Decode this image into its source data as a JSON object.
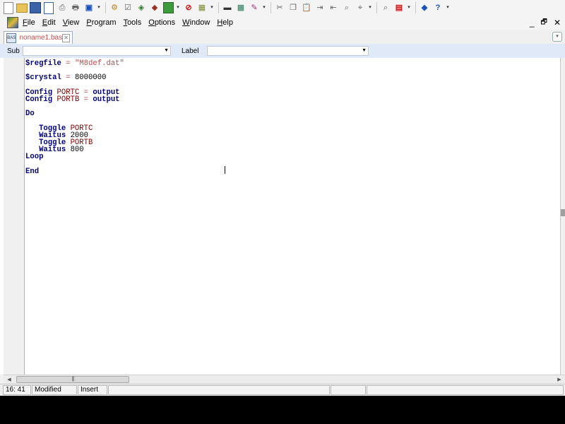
{
  "menu": {
    "items": [
      {
        "label": "File",
        "u": "F",
        "rest": "ile"
      },
      {
        "label": "Edit",
        "u": "E",
        "rest": "dit"
      },
      {
        "label": "View",
        "u": "V",
        "rest": "iew"
      },
      {
        "label": "Program",
        "u": "P",
        "rest": "rogram"
      },
      {
        "label": "Tools",
        "u": "T",
        "rest": "ools"
      },
      {
        "label": "Options",
        "u": "O",
        "rest": "ptions"
      },
      {
        "label": "Window",
        "u": "W",
        "rest": "indow"
      },
      {
        "label": "Help",
        "u": "H",
        "rest": "elp"
      }
    ],
    "window_controls": {
      "minimize": "_",
      "restore": "🗗",
      "close": "✕"
    }
  },
  "tabs": [
    {
      "label": "noname1.bas",
      "icon": "bas-file-icon",
      "icon_text": "BAS"
    }
  ],
  "subbar": {
    "sub_label": "Sub",
    "label_label": "Label",
    "sub_value": "",
    "label_value": ""
  },
  "editor": {
    "lines": [
      [
        {
          "t": "$regfile",
          "c": "kw"
        },
        {
          "t": " = ",
          "c": "str"
        },
        {
          "t": "\"M8def.dat\"",
          "c": "str"
        }
      ],
      [],
      [
        {
          "t": "$crystal",
          "c": "kw"
        },
        {
          "t": " = ",
          "c": "str"
        },
        {
          "t": "8000000",
          "c": "num"
        }
      ],
      [],
      [
        {
          "t": "Config",
          "c": "kw"
        },
        {
          "t": " PORTC",
          "c": "id"
        },
        {
          "t": " = ",
          "c": "str"
        },
        {
          "t": "output",
          "c": "kw"
        }
      ],
      [
        {
          "t": "Config",
          "c": "kw"
        },
        {
          "t": " PORTB",
          "c": "id"
        },
        {
          "t": " = ",
          "c": "str"
        },
        {
          "t": "output",
          "c": "kw"
        }
      ],
      [],
      [
        {
          "t": "Do",
          "c": "kw"
        }
      ],
      [],
      [
        {
          "t": "   Toggle",
          "c": "kw"
        },
        {
          "t": " PORTC",
          "c": "id"
        }
      ],
      [
        {
          "t": "   Waitus",
          "c": "kw"
        },
        {
          "t": " 2000",
          "c": "num"
        }
      ],
      [
        {
          "t": "   Toggle",
          "c": "kw"
        },
        {
          "t": " PORTB",
          "c": "id"
        }
      ],
      [
        {
          "t": "   Waitus",
          "c": "kw"
        },
        {
          "t": " 800",
          "c": "num"
        }
      ],
      [
        {
          "t": "Loop",
          "c": "kw"
        }
      ],
      [],
      [
        {
          "t": "End",
          "c": "kw"
        }
      ]
    ]
  },
  "hscroll": {
    "thumb_grip": "|||"
  },
  "status": {
    "position": "16: 41",
    "modified": "Modified",
    "mode": "Insert"
  },
  "toolbar": {
    "icons": [
      "new-file-icon",
      "open-folder-icon",
      "save-icon",
      "save-all-icon",
      "print-preview-icon",
      "print-icon",
      "module-icon",
      "compile-icon",
      "syntax-check-icon",
      "program-chip-icon",
      "terminal-icon",
      "simulate-icon",
      "stop-icon",
      "chip-icon",
      "lcd-icon",
      "graphic-icon",
      "font-icon",
      "cut-icon",
      "copy-icon",
      "paste-icon",
      "indent-icon",
      "unindent-icon",
      "find-icon",
      "replace-icon",
      "find-next-icon",
      "pdf-icon",
      "bookmark-icon",
      "help-icon"
    ]
  }
}
